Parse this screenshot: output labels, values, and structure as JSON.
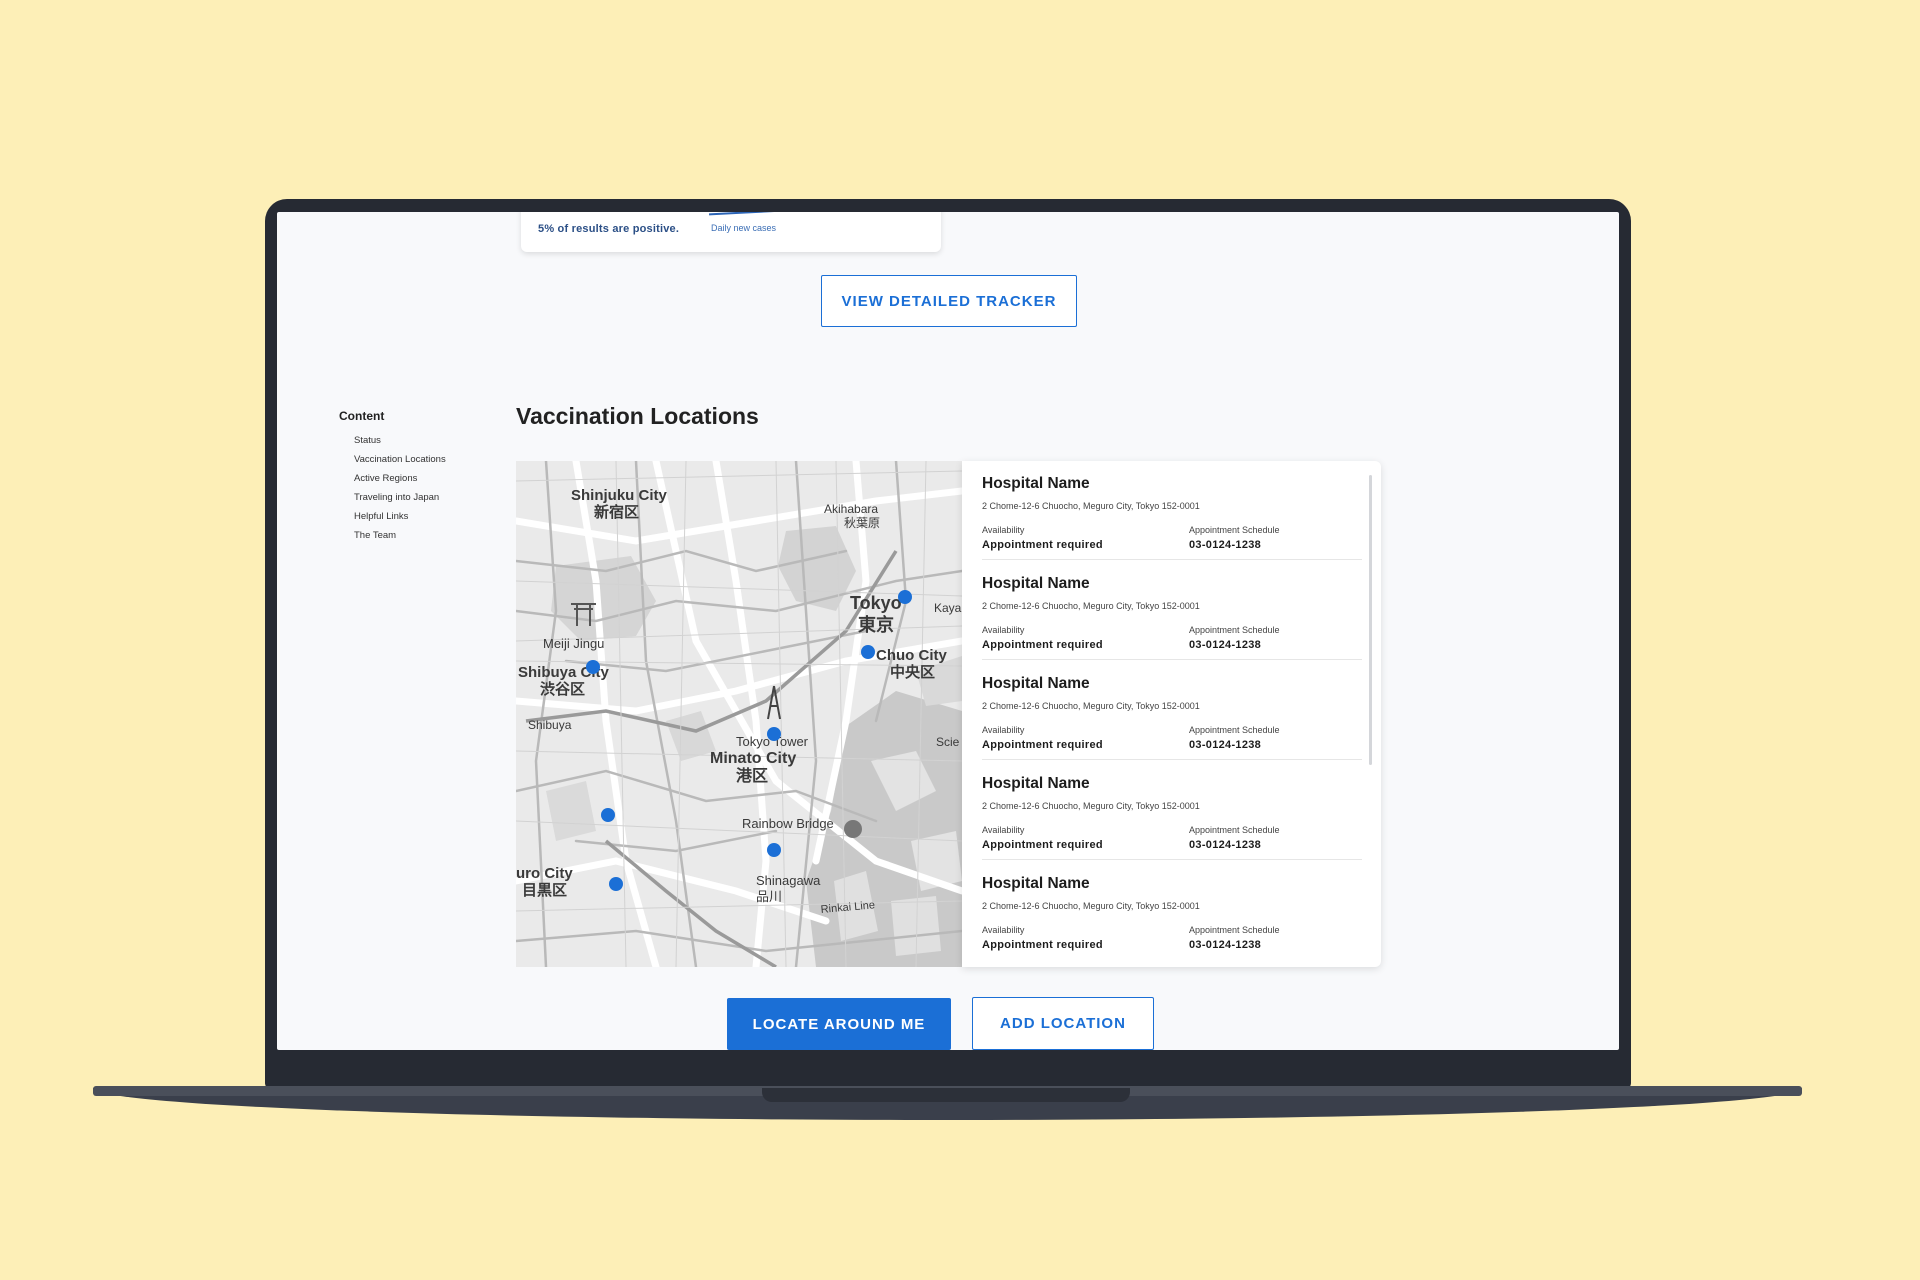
{
  "stats": {
    "positive_text": "5% of results are positive.",
    "daily_label": "Daily new cases"
  },
  "tracker_button": "VIEW DETAILED TRACKER",
  "toc": {
    "title": "Content",
    "items": [
      "Status",
      "Vaccination Locations",
      "Active Regions",
      "Traveling into Japan",
      "Helpful Links",
      "The Team"
    ]
  },
  "section_title": "Vaccination Locations",
  "map_labels": {
    "shinjuku": "Shinjuku City",
    "shinjuku_jp": "新宿区",
    "akihabara": "Akihabara",
    "akihabara_jp": "秋葉原",
    "tokyo": "Tokyo",
    "tokyo_jp": "東京",
    "meiji": "Meiji Jingu",
    "shibuya_city": "Shibuya City",
    "shibuya_jp": "渋谷区",
    "shibuya": "Shibuya",
    "chuo": "Chuo City",
    "chuo_jp": "中央区",
    "tokyo_tower": "Tokyo Tower",
    "minato": "Minato City",
    "minato_jp": "港区",
    "rainbow": "Rainbow Bridge",
    "meguro": "uro City",
    "meguro_jp": "目黒区",
    "shinagawa": "Shinagawa",
    "shinagawa_jp": "品川",
    "rinkai": "Rinkai Line",
    "kaya": "Kaya",
    "scie": "Scie"
  },
  "hospitals": [
    {
      "name": "Hospital Name",
      "address": "2 Chome-12-6 Chuocho, Meguro City, Tokyo 152-0001",
      "availability_label": "Availability",
      "availability": "Appointment required",
      "schedule_label": "Appointment Schedule",
      "phone": "03-0124-1238"
    },
    {
      "name": "Hospital Name",
      "address": "2 Chome-12-6 Chuocho, Meguro City, Tokyo 152-0001",
      "availability_label": "Availability",
      "availability": "Appointment required",
      "schedule_label": "Appointment Schedule",
      "phone": "03-0124-1238"
    },
    {
      "name": "Hospital Name",
      "address": "2 Chome-12-6 Chuocho, Meguro City, Tokyo 152-0001",
      "availability_label": "Availability",
      "availability": "Appointment required",
      "schedule_label": "Appointment Schedule",
      "phone": "03-0124-1238"
    },
    {
      "name": "Hospital Name",
      "address": "2 Chome-12-6 Chuocho, Meguro City, Tokyo 152-0001",
      "availability_label": "Availability",
      "availability": "Appointment required",
      "schedule_label": "Appointment Schedule",
      "phone": "03-0124-1238"
    },
    {
      "name": "Hospital Name",
      "address": "2 Chome-12-6 Chuocho, Meguro City, Tokyo 152-0001",
      "availability_label": "Availability",
      "availability": "Appointment required",
      "schedule_label": "Appointment Schedule",
      "phone": "03-0124-1238"
    }
  ],
  "actions": {
    "locate": "LOCATE AROUND ME",
    "add": "ADD LOCATION"
  },
  "colors": {
    "accent": "#1b6fd6",
    "background": "#fdefb7",
    "marker": "#1b6fd6"
  }
}
